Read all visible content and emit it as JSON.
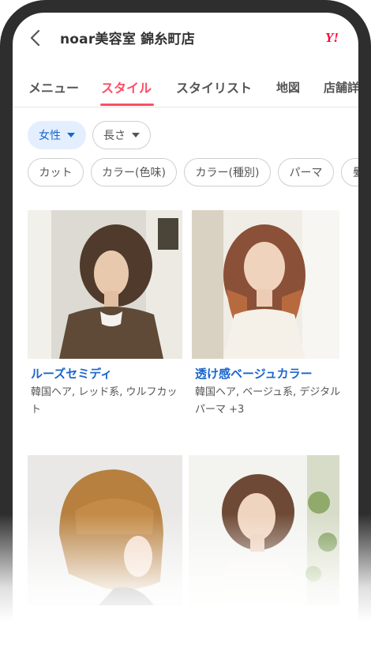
{
  "header": {
    "title": "noar美容室 錦糸町店",
    "logo_text": "Y!",
    "logo_color": "#ff0033"
  },
  "tabs": [
    {
      "label": "メニュー",
      "active": false
    },
    {
      "label": "スタイル",
      "active": true
    },
    {
      "label": "スタイリスト",
      "active": false
    },
    {
      "label": "地図",
      "active": false
    },
    {
      "label": "店舗詳",
      "active": false
    }
  ],
  "filters": {
    "dropdowns": [
      {
        "label": "女性",
        "selected": true
      },
      {
        "label": "長さ",
        "selected": false
      }
    ],
    "chips": [
      "カット",
      "カラー(色味)",
      "カラー(種別)",
      "パーマ",
      "髪"
    ]
  },
  "styles": [
    {
      "title": "ルーズセミディ",
      "tags": "韓国ヘア, レッド系, ウルフカット"
    },
    {
      "title": "透け感ベージュカラー",
      "tags": "韓国ヘア, ベージュ系, デジタルパーマ +3"
    },
    {
      "title": "",
      "tags": ""
    },
    {
      "title": "",
      "tags": ""
    }
  ],
  "colors": {
    "accent": "#ff4d64",
    "link": "#1a66cc",
    "selected_chip_bg": "#e3efff"
  }
}
